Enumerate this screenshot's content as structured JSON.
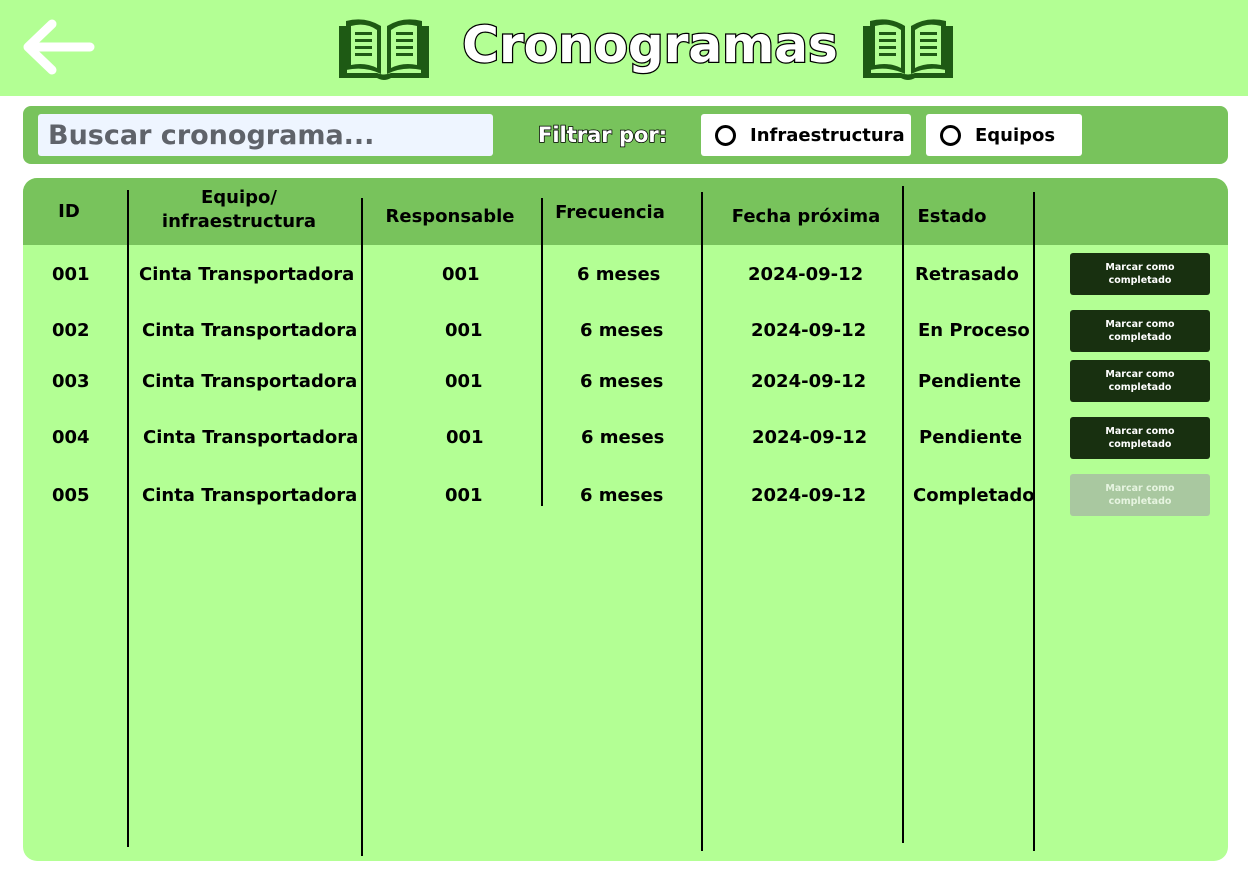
{
  "header": {
    "title": "Cronogramas",
    "back_icon": "arrow-left-icon",
    "book_icon": "open-book-icon",
    "bg_color": "#b3ff94",
    "book_color": "#1e5a14"
  },
  "toolbar": {
    "search_placeholder": "Buscar cronograma...",
    "filter_label": "Filtrar por:",
    "filters": [
      {
        "label": "Infraestructura",
        "selected": false
      },
      {
        "label": "Equipos",
        "selected": false
      }
    ],
    "bg_color": "#78c35c"
  },
  "table": {
    "columns": [
      "ID",
      "Equipo/\ninfraestructura",
      "Responsable",
      "Frecuencia",
      "Fecha próxima",
      "Estado"
    ],
    "rows": [
      {
        "id": "001",
        "equipo": "Cinta Transportadora",
        "responsable": "001",
        "frecuencia": "6 meses",
        "fecha": "2024-09-12",
        "estado": "Retrasado",
        "action": "Marcar como completado",
        "action_enabled": true
      },
      {
        "id": "002",
        "equipo": "Cinta Transportadora",
        "responsable": "001",
        "frecuencia": "6 meses",
        "fecha": "2024-09-12",
        "estado": "En Proceso",
        "action": "Marcar como completado",
        "action_enabled": true
      },
      {
        "id": "003",
        "equipo": "Cinta Transportadora",
        "responsable": "001",
        "frecuencia": "6 meses",
        "fecha": "2024-09-12",
        "estado": "Pendiente",
        "action": "Marcar como completado",
        "action_enabled": true
      },
      {
        "id": "004",
        "equipo": "Cinta Transportadora",
        "responsable": "001",
        "frecuencia": "6 meses",
        "fecha": "2024-09-12",
        "estado": "Pendiente",
        "action": "Marcar como completado",
        "action_enabled": true
      },
      {
        "id": "005",
        "equipo": "Cinta Transportadora",
        "responsable": "001",
        "frecuencia": "6 meses",
        "fecha": "2024-09-12",
        "estado": "Completado",
        "action": "Marcar como completado",
        "action_enabled": false
      }
    ],
    "header_color": "#78c35c",
    "body_color": "#b3ff94",
    "button_color": "#183010",
    "button_disabled_color": "#a9c8a0"
  }
}
